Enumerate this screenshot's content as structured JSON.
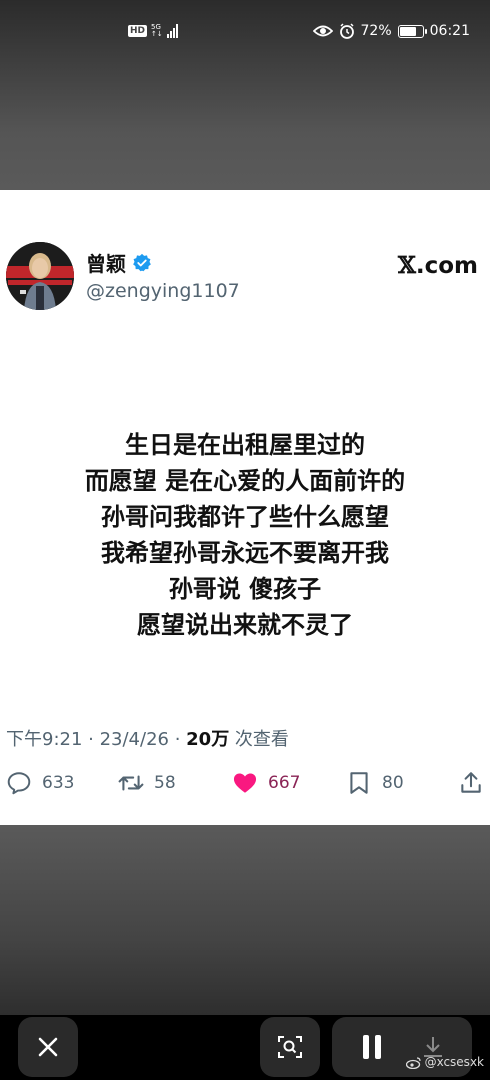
{
  "status_bar": {
    "hd": "HD",
    "network_top": "5G",
    "network_bottom": "↑↓",
    "battery_percent": "72%",
    "time": "06:21"
  },
  "post": {
    "display_name": "曾颖",
    "handle": "@zengying1107",
    "site_x": "𝕏",
    "site_suffix": ".com",
    "lines": [
      "生日是在出租屋里过的",
      "而愿望 是在心爱的人面前许的",
      "孙哥问我都许了些什么愿望",
      "我希望孙哥永远不要离开我",
      "孙哥说 傻孩子",
      "愿望说出来就不灵了"
    ],
    "timestamp": "下午9:21 · 23/4/26 · ",
    "views_count": "20万",
    "views_label": " 次查看",
    "replies": "633",
    "reposts": "58",
    "likes": "667",
    "bookmarks": "80"
  },
  "bottom_bar": {
    "watermark": "@xcsesxk"
  },
  "colors": {
    "verified": "#1d9bf0",
    "like": "#f91880",
    "secondary_text": "#536471"
  }
}
